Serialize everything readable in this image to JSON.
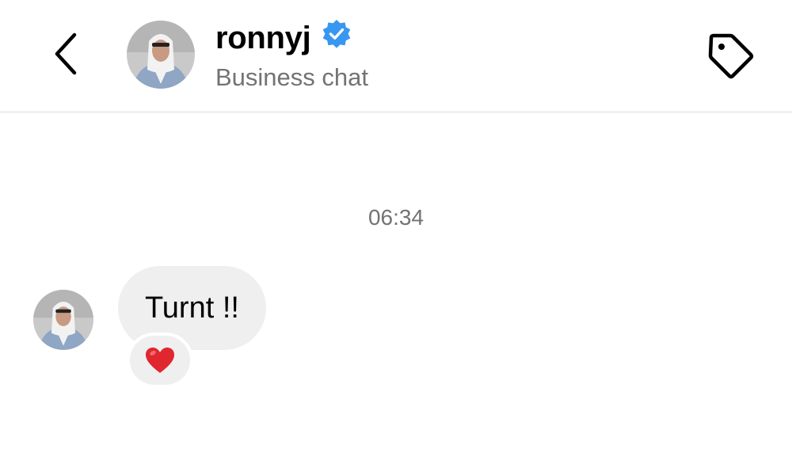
{
  "header": {
    "username": "ronnyj",
    "subtitle": "Business chat",
    "icons": {
      "back": "chevron-left-icon",
      "verified": "verified-badge-icon",
      "tag": "tag-icon"
    },
    "colors": {
      "verified": "#3897f0",
      "subtitle": "#737373"
    }
  },
  "conversation": {
    "timestamp": "06:34",
    "messages": [
      {
        "sender": "ronnyj",
        "text": "Turnt !!",
        "reaction": "heart"
      }
    ]
  },
  "colors": {
    "bubble": "#efefef",
    "divider": "#dbdbdb",
    "heart": "#e0262f"
  }
}
